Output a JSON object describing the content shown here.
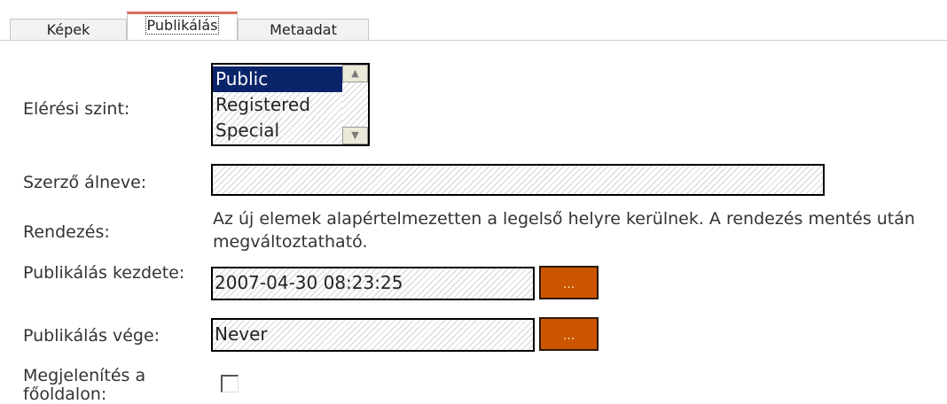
{
  "tabs": [
    {
      "label": "Képek",
      "active": false
    },
    {
      "label": "Publikálás",
      "active": true
    },
    {
      "label": "Metaadat",
      "active": false
    }
  ],
  "access": {
    "label": "Elérési szint:",
    "options": [
      "Public",
      "Registered",
      "Special"
    ],
    "selected": "Public"
  },
  "author_alias": {
    "label": "Szerző álneve:",
    "value": ""
  },
  "ordering": {
    "label": "Rendezés:",
    "note": "Az új elemek alapértelmezetten a legelső helyre kerülnek. A rendezés mentés után megváltoztatható."
  },
  "publish_up": {
    "label": "Publikálás kezdete:",
    "value": "2007-04-30 08:23:25",
    "button": "..."
  },
  "publish_down": {
    "label": "Publikálás vége:",
    "value": "Never",
    "button": "..."
  },
  "frontpage": {
    "label": "Megjelenítés a főoldalon:",
    "checked": false
  },
  "colors": {
    "selection": "#0a246a",
    "calendar_button": "#cc5500",
    "active_tab_accent": "#d96a5a"
  }
}
